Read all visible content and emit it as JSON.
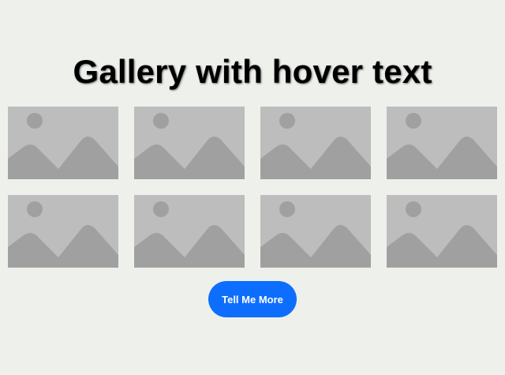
{
  "page": {
    "title": "Gallery with hover text"
  },
  "gallery": {
    "items": [
      {
        "icon": "image-placeholder-icon"
      },
      {
        "icon": "image-placeholder-icon"
      },
      {
        "icon": "image-placeholder-icon"
      },
      {
        "icon": "image-placeholder-icon"
      },
      {
        "icon": "image-placeholder-icon"
      },
      {
        "icon": "image-placeholder-icon"
      },
      {
        "icon": "image-placeholder-icon"
      },
      {
        "icon": "image-placeholder-icon"
      }
    ]
  },
  "cta": {
    "label": "Tell Me More"
  },
  "colors": {
    "background": "#eef0ec",
    "placeholder_bg": "#bdbdbd",
    "placeholder_shape": "#a0a0a0",
    "accent": "#0d6efd",
    "button_text": "#ffffff"
  }
}
